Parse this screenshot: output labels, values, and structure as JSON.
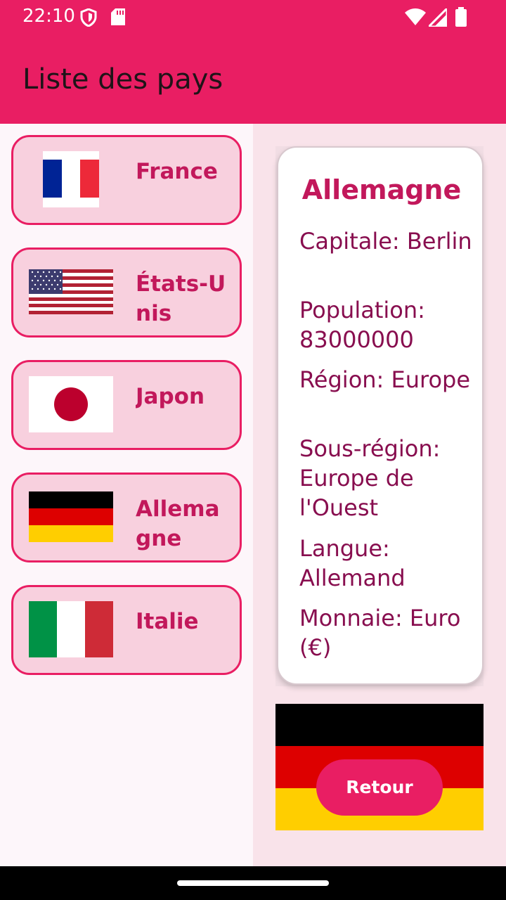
{
  "status_bar": {
    "time": "22:10",
    "icons": [
      "shield-icon",
      "sdcard-icon",
      "wifi-icon",
      "signal-icon",
      "battery-icon"
    ]
  },
  "app_bar": {
    "title": "Liste des pays"
  },
  "country_list": [
    {
      "name": "France",
      "flag": "flag-france"
    },
    {
      "name": "États-Unis",
      "flag": "flag-usa"
    },
    {
      "name": "Japon",
      "flag": "flag-japan"
    },
    {
      "name": "Allemagne",
      "flag": "flag-germany"
    },
    {
      "name": "Italie",
      "flag": "flag-italy"
    }
  ],
  "detail": {
    "country": "Allemagne",
    "capital": "Capitale: Berlin",
    "population": "Population: 83000000",
    "region": "Région: Europe",
    "subregion": "Sous-région: Europe de l'Ouest",
    "language": "Langue: Allemand",
    "currency": "Monnaie: Euro (€)",
    "flag": "flag-germany",
    "back_label": "Retour"
  },
  "colors": {
    "primary": "#e91e63",
    "card_bg": "#f8d0de",
    "text_accent": "#c2185b",
    "text_detail": "#880e4f",
    "germany": [
      "#000000",
      "#dd0000",
      "#ffce00"
    ],
    "france": [
      "#002395",
      "#ffffff",
      "#ed2939"
    ],
    "italy": [
      "#009246",
      "#ffffff",
      "#ce2b37"
    ],
    "japan_red": "#bc002d",
    "usa": [
      "#b22234",
      "#ffffff",
      "#3c3b6e"
    ]
  }
}
